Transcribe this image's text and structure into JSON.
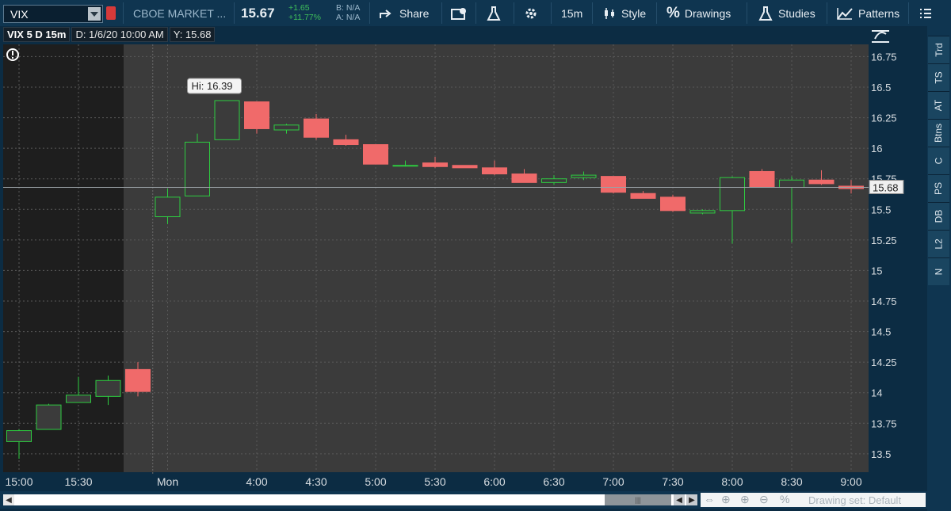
{
  "toolbar": {
    "symbol": "VIX",
    "company": "CBOE MARKET ...",
    "last": "15.67",
    "change": "+1.65",
    "change_pct": "+11.77%",
    "bid": "B: N/A",
    "ask": "A: N/A",
    "share_label": "Share",
    "timeframe_label": "15m",
    "style_label": "Style",
    "drawings_label": "Drawings",
    "studies_label": "Studies",
    "patterns_label": "Patterns"
  },
  "chart_header": {
    "title": "VIX 5 D 15m",
    "date": "D: 1/6/20 10:00 AM",
    "y": "Y: 15.68"
  },
  "right_tabs": [
    "Trd",
    "TS",
    "AT",
    "Btns",
    "C",
    "PS",
    "DB",
    "L2",
    "N"
  ],
  "bottom": {
    "drawing_set": "Drawing set: Default"
  },
  "colors": {
    "up": "#2ecc40",
    "down": "#f06a6a",
    "bg": "#3b3b3b",
    "pre_bg": "#1e1e1e"
  },
  "chart_data": {
    "type": "candlestick",
    "title": "VIX 5 D 15m",
    "ylim": [
      13.35,
      16.85
    ],
    "y_ticks": [
      "16.75",
      "16.5",
      "16.25",
      "16",
      "15.75",
      "15.5",
      "15.25",
      "15",
      "14.75",
      "14.5",
      "14.25",
      "14",
      "13.75",
      "13.5"
    ],
    "x_ticks": [
      {
        "index": 0,
        "label": "15:00"
      },
      {
        "index": 2,
        "label": "15:30"
      },
      {
        "index": 5,
        "label": "Mon"
      },
      {
        "index": 8,
        "label": "4:00"
      },
      {
        "index": 10,
        "label": "4:30"
      },
      {
        "index": 12,
        "label": "5:00"
      },
      {
        "index": 14,
        "label": "5:30"
      },
      {
        "index": 16,
        "label": "6:00"
      },
      {
        "index": 18,
        "label": "6:30"
      },
      {
        "index": 20,
        "label": "7:00"
      },
      {
        "index": 22,
        "label": "7:30"
      },
      {
        "index": 24,
        "label": "8:00"
      },
      {
        "index": 26,
        "label": "8:30"
      },
      {
        "index": 28,
        "label": "9:00"
      }
    ],
    "session_break_index": 4,
    "candles": [
      {
        "o": 13.6,
        "h": 13.7,
        "l": 13.46,
        "c": 13.69
      },
      {
        "o": 13.7,
        "h": 13.91,
        "l": 13.7,
        "c": 13.9
      },
      {
        "o": 13.92,
        "h": 14.13,
        "l": 13.92,
        "c": 13.98
      },
      {
        "o": 13.97,
        "h": 14.14,
        "l": 13.9,
        "c": 14.1
      },
      {
        "o": 14.19,
        "h": 14.25,
        "l": 13.97,
        "c": 14.01
      },
      {
        "o": 15.44,
        "h": 15.67,
        "l": 15.38,
        "c": 15.6
      },
      {
        "o": 15.61,
        "h": 16.12,
        "l": 15.61,
        "c": 16.05
      },
      {
        "o": 16.07,
        "h": 16.39,
        "l": 16.07,
        "c": 16.39
      },
      {
        "o": 16.38,
        "h": 16.38,
        "l": 16.12,
        "c": 16.16
      },
      {
        "o": 16.15,
        "h": 16.2,
        "l": 16.12,
        "c": 16.19
      },
      {
        "o": 16.24,
        "h": 16.28,
        "l": 16.07,
        "c": 16.09
      },
      {
        "o": 16.07,
        "h": 16.11,
        "l": 16.02,
        "c": 16.03
      },
      {
        "o": 16.03,
        "h": 16.03,
        "l": 15.87,
        "c": 15.87
      },
      {
        "o": 15.86,
        "h": 15.9,
        "l": 15.85,
        "c": 15.86
      },
      {
        "o": 15.88,
        "h": 15.93,
        "l": 15.84,
        "c": 15.85
      },
      {
        "o": 15.86,
        "h": 15.86,
        "l": 15.84,
        "c": 15.84
      },
      {
        "o": 15.84,
        "h": 15.9,
        "l": 15.78,
        "c": 15.79
      },
      {
        "o": 15.79,
        "h": 15.83,
        "l": 15.72,
        "c": 15.72
      },
      {
        "o": 15.72,
        "h": 15.78,
        "l": 15.7,
        "c": 15.75
      },
      {
        "o": 15.76,
        "h": 15.81,
        "l": 15.74,
        "c": 15.78
      },
      {
        "o": 15.77,
        "h": 15.77,
        "l": 15.63,
        "c": 15.64
      },
      {
        "o": 15.63,
        "h": 15.65,
        "l": 15.59,
        "c": 15.59
      },
      {
        "o": 15.6,
        "h": 15.62,
        "l": 15.48,
        "c": 15.49
      },
      {
        "o": 15.47,
        "h": 15.5,
        "l": 15.46,
        "c": 15.49
      },
      {
        "o": 15.49,
        "h": 15.77,
        "l": 15.22,
        "c": 15.76
      },
      {
        "o": 15.81,
        "h": 15.83,
        "l": 15.68,
        "c": 15.68
      },
      {
        "o": 15.68,
        "h": 15.77,
        "l": 15.23,
        "c": 15.74
      },
      {
        "o": 15.74,
        "h": 15.82,
        "l": 15.7,
        "c": 15.71
      },
      {
        "o": 15.69,
        "h": 15.74,
        "l": 15.63,
        "c": 15.67
      }
    ],
    "crosshair_y": 15.68,
    "crosshair_label": "15.68",
    "hi_label": "Hi: 16.39",
    "hi_index": 7
  }
}
